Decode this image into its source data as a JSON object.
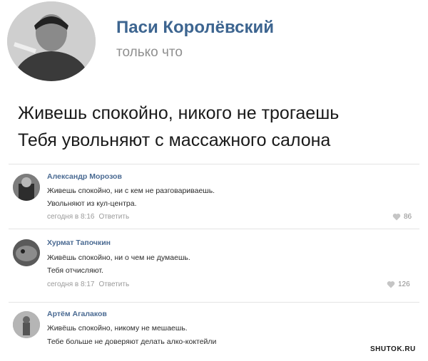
{
  "post": {
    "author": "Паси Королёвский",
    "time": "только что",
    "lines": [
      "Живешь спокойно, никого не трогаешь",
      "Тебя увольняют с массажного салона"
    ]
  },
  "comments": [
    {
      "name": "Александр Морозов",
      "lines": [
        "Живешь спокойно, ни с кем не разговариваешь.",
        "Увольняют из кул-центра."
      ],
      "time": "сегодня в 8:16",
      "reply": "Ответить",
      "likes": "86"
    },
    {
      "name": "Хурмат Тапочкин",
      "lines": [
        "Живёшь спокойно, ни о чем не думаешь.",
        "Тебя отчисляют."
      ],
      "time": "сегодня в 8:17",
      "reply": "Ответить",
      "likes": "126"
    },
    {
      "name": "Артём Агалаков",
      "lines": [
        "Живёшь спокойно, никому не мешаешь.",
        "Тебе больше не доверяют делать алко-коктейли"
      ]
    }
  ],
  "watermark": "SHUTOK.RU",
  "icons": {
    "like": "heart-icon"
  },
  "colors": {
    "author_link": "#3d6590",
    "comment_name": "#4a6a92",
    "meta_gray": "#9a9a9a"
  }
}
